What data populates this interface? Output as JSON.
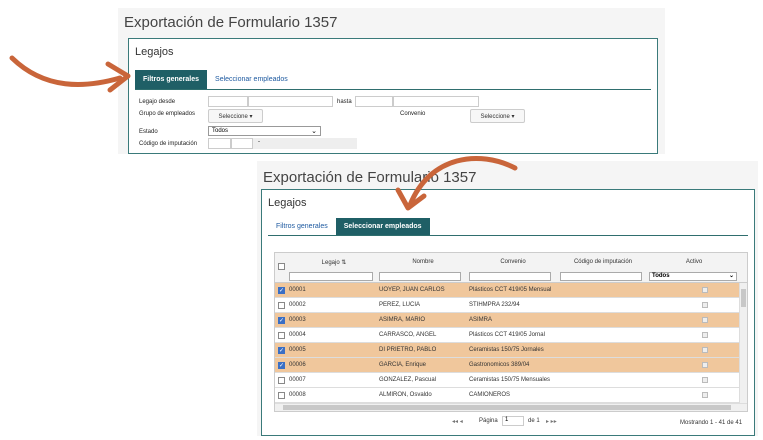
{
  "shot1": {
    "title": "Exportación de Formulario 1357",
    "panel_title": "Legajos",
    "tabs": [
      {
        "label": "Filtros generales",
        "active": true
      },
      {
        "label": "Seleccionar empleados",
        "active": false
      }
    ],
    "labels": {
      "legajo_desde": "Legajo desde",
      "hasta": "hasta",
      "grupo": "Grupo de empleados",
      "convenio": "Convenio",
      "estado": "Estado",
      "codigo": "Código de imputación"
    },
    "seleccione": "Seleccione ▾",
    "estado_value": "Todos",
    "dash": "-"
  },
  "shot2": {
    "title": "Exportación de Formulario 1357",
    "panel_title": "Legajos",
    "tabs": [
      {
        "label": "Filtros generales",
        "active": false
      },
      {
        "label": "Seleccionar empleados",
        "active": true
      }
    ],
    "columns": [
      "Legajo ⇅",
      "Nombre",
      "Convenio",
      "Código de imputación",
      "Activo"
    ],
    "activo_filter": "Todos",
    "rows": [
      {
        "legajo": "00001",
        "nombre": "UOYEP, JUAN CARLOS",
        "convenio": "Plásticos CCT 419/05 Mensual",
        "selected": true
      },
      {
        "legajo": "00002",
        "nombre": "PEREZ, LUCIA",
        "convenio": "STIHMPRA 232/94",
        "selected": false
      },
      {
        "legajo": "00003",
        "nombre": "ASIMRA, MARIO",
        "convenio": "ASIMRA",
        "selected": true
      },
      {
        "legajo": "00004",
        "nombre": "CARRASCO, ANGEL",
        "convenio": "Plásticos CCT 419/05 Jornal",
        "selected": false
      },
      {
        "legajo": "00005",
        "nombre": "DI PRIETRO, PABLO",
        "convenio": "Ceramistas 150/75 Jornales",
        "selected": true
      },
      {
        "legajo": "00006",
        "nombre": "GARCIA, Enrique",
        "convenio": "Gastronomicos 389/04",
        "selected": true
      },
      {
        "legajo": "00007",
        "nombre": "GONZALEZ, Pascual",
        "convenio": "Ceramistas 150/75 Mensuales",
        "selected": false
      },
      {
        "legajo": "00008",
        "nombre": "ALMIRON, Osvaldo",
        "convenio": "CAMIONEROS",
        "selected": false
      }
    ],
    "pager": {
      "pagina": "Página",
      "page": "1",
      "de": "de 1",
      "nav_prev": "◂◂ ◂",
      "nav_next": "▸ ▸▸",
      "mostrando": "Mostrando 1 - 41 de 41"
    }
  },
  "colors": {
    "accent": "#1f5f66",
    "selected_row": "#f0c79c",
    "arrow": "#c9653a",
    "checkbox": "#3b6fc4"
  }
}
